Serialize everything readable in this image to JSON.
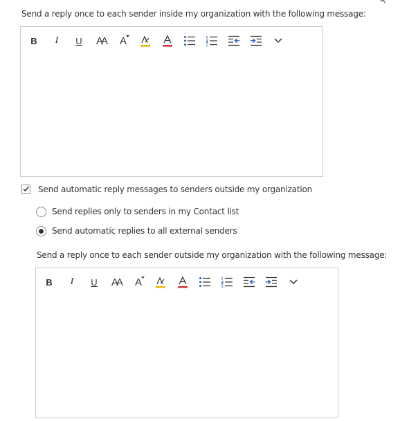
{
  "internal": {
    "message_label": "Send a reply once to each sender inside my organization with the following message:",
    "body_text": ""
  },
  "external": {
    "enable_label": "Send automatic reply messages to senders outside my organization",
    "enable_checked": true,
    "option_contacts_label": "Send replies only to senders in my Contact list",
    "option_all_label": "Send automatic replies to all external senders",
    "selected_option": "all",
    "message_label": "Send a reply once to each sender outside my organization with the following message:",
    "body_text": ""
  },
  "toolbar": {
    "bold": "B",
    "italic": "I",
    "underline": "U",
    "font_size": "AA",
    "grow_font": "A",
    "font_color": "A",
    "items": [
      "bold",
      "italic",
      "underline",
      "font-size",
      "grow-font",
      "highlight",
      "font-color",
      "bullets",
      "numbering",
      "decrease-indent",
      "increase-indent",
      "more"
    ]
  },
  "colors": {
    "highlight": "#e8b500",
    "font_color": "#d13438",
    "indent_arrow": "#1f5fb8",
    "text": "#333333",
    "border": "#c8c8c8"
  }
}
